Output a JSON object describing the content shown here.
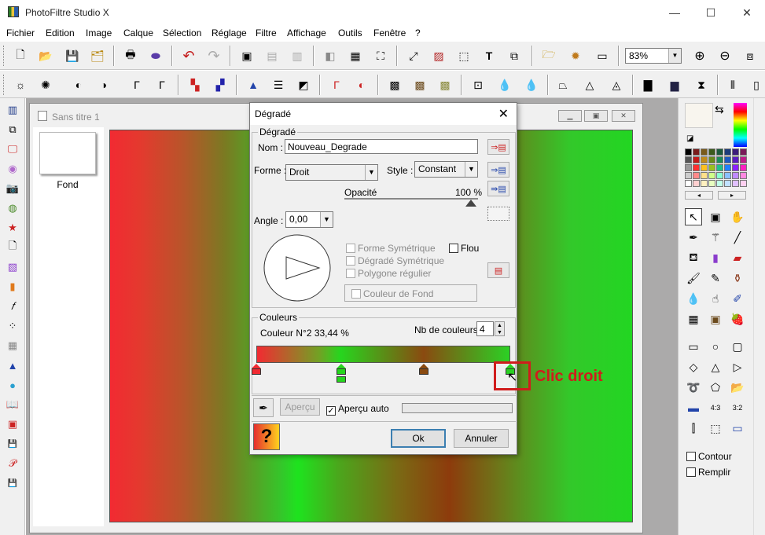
{
  "window": {
    "title": "PhotoFiltre Studio X",
    "minimize": "—",
    "maximize": "☐",
    "close": "✕"
  },
  "menu": [
    "Fichier",
    "Edition",
    "Image",
    "Calque",
    "Sélection",
    "Réglage",
    "Filtre",
    "Affichage",
    "Outils",
    "Fenêtre",
    "?"
  ],
  "toolbar": {
    "zoom_value": "83%"
  },
  "document": {
    "title": "Sans titre 1",
    "layer_name": "Fond"
  },
  "dialog": {
    "title": "Dégradé",
    "group_gradient": "Dégradé",
    "name_label": "Nom :",
    "name_value": "Nouveau_Degrade",
    "shape_label": "Forme :",
    "shape_value": "Droit",
    "style_label": "Style :",
    "style_value": "Constant",
    "opacity_label": "Opacité",
    "opacity_value": "100 %",
    "angle_label": "Angle :",
    "angle_value": "0,00",
    "chk_symmetric_shape": "Forme Symétrique",
    "chk_blur": "Flou",
    "chk_symmetric_gradient": "Dégradé Symétrique",
    "chk_regular_polygon": "Polygone régulier",
    "chk_bg_color": "Couleur de Fond",
    "group_colors": "Couleurs",
    "color_info": "Couleur N°2 33,44 %",
    "num_colors_label": "Nb de couleurs :",
    "num_colors_value": "4",
    "preview_button": "Aperçu",
    "auto_preview": "Aperçu auto",
    "ok": "Ok",
    "cancel": "Annuler",
    "stops": [
      {
        "color": "#f22a32",
        "position": 0
      },
      {
        "color": "#26d61e",
        "position": 33.44
      },
      {
        "color": "#8a4a10",
        "position": 66
      },
      {
        "color": "#2bd124",
        "position": 100
      }
    ]
  },
  "annotation": {
    "text": "Clic droit"
  },
  "right_panel": {
    "outline_label": "Contour",
    "fill_label": "Remplir"
  },
  "colors": {
    "accent": "#d01c1c",
    "default_button": "#3c7fb1"
  }
}
